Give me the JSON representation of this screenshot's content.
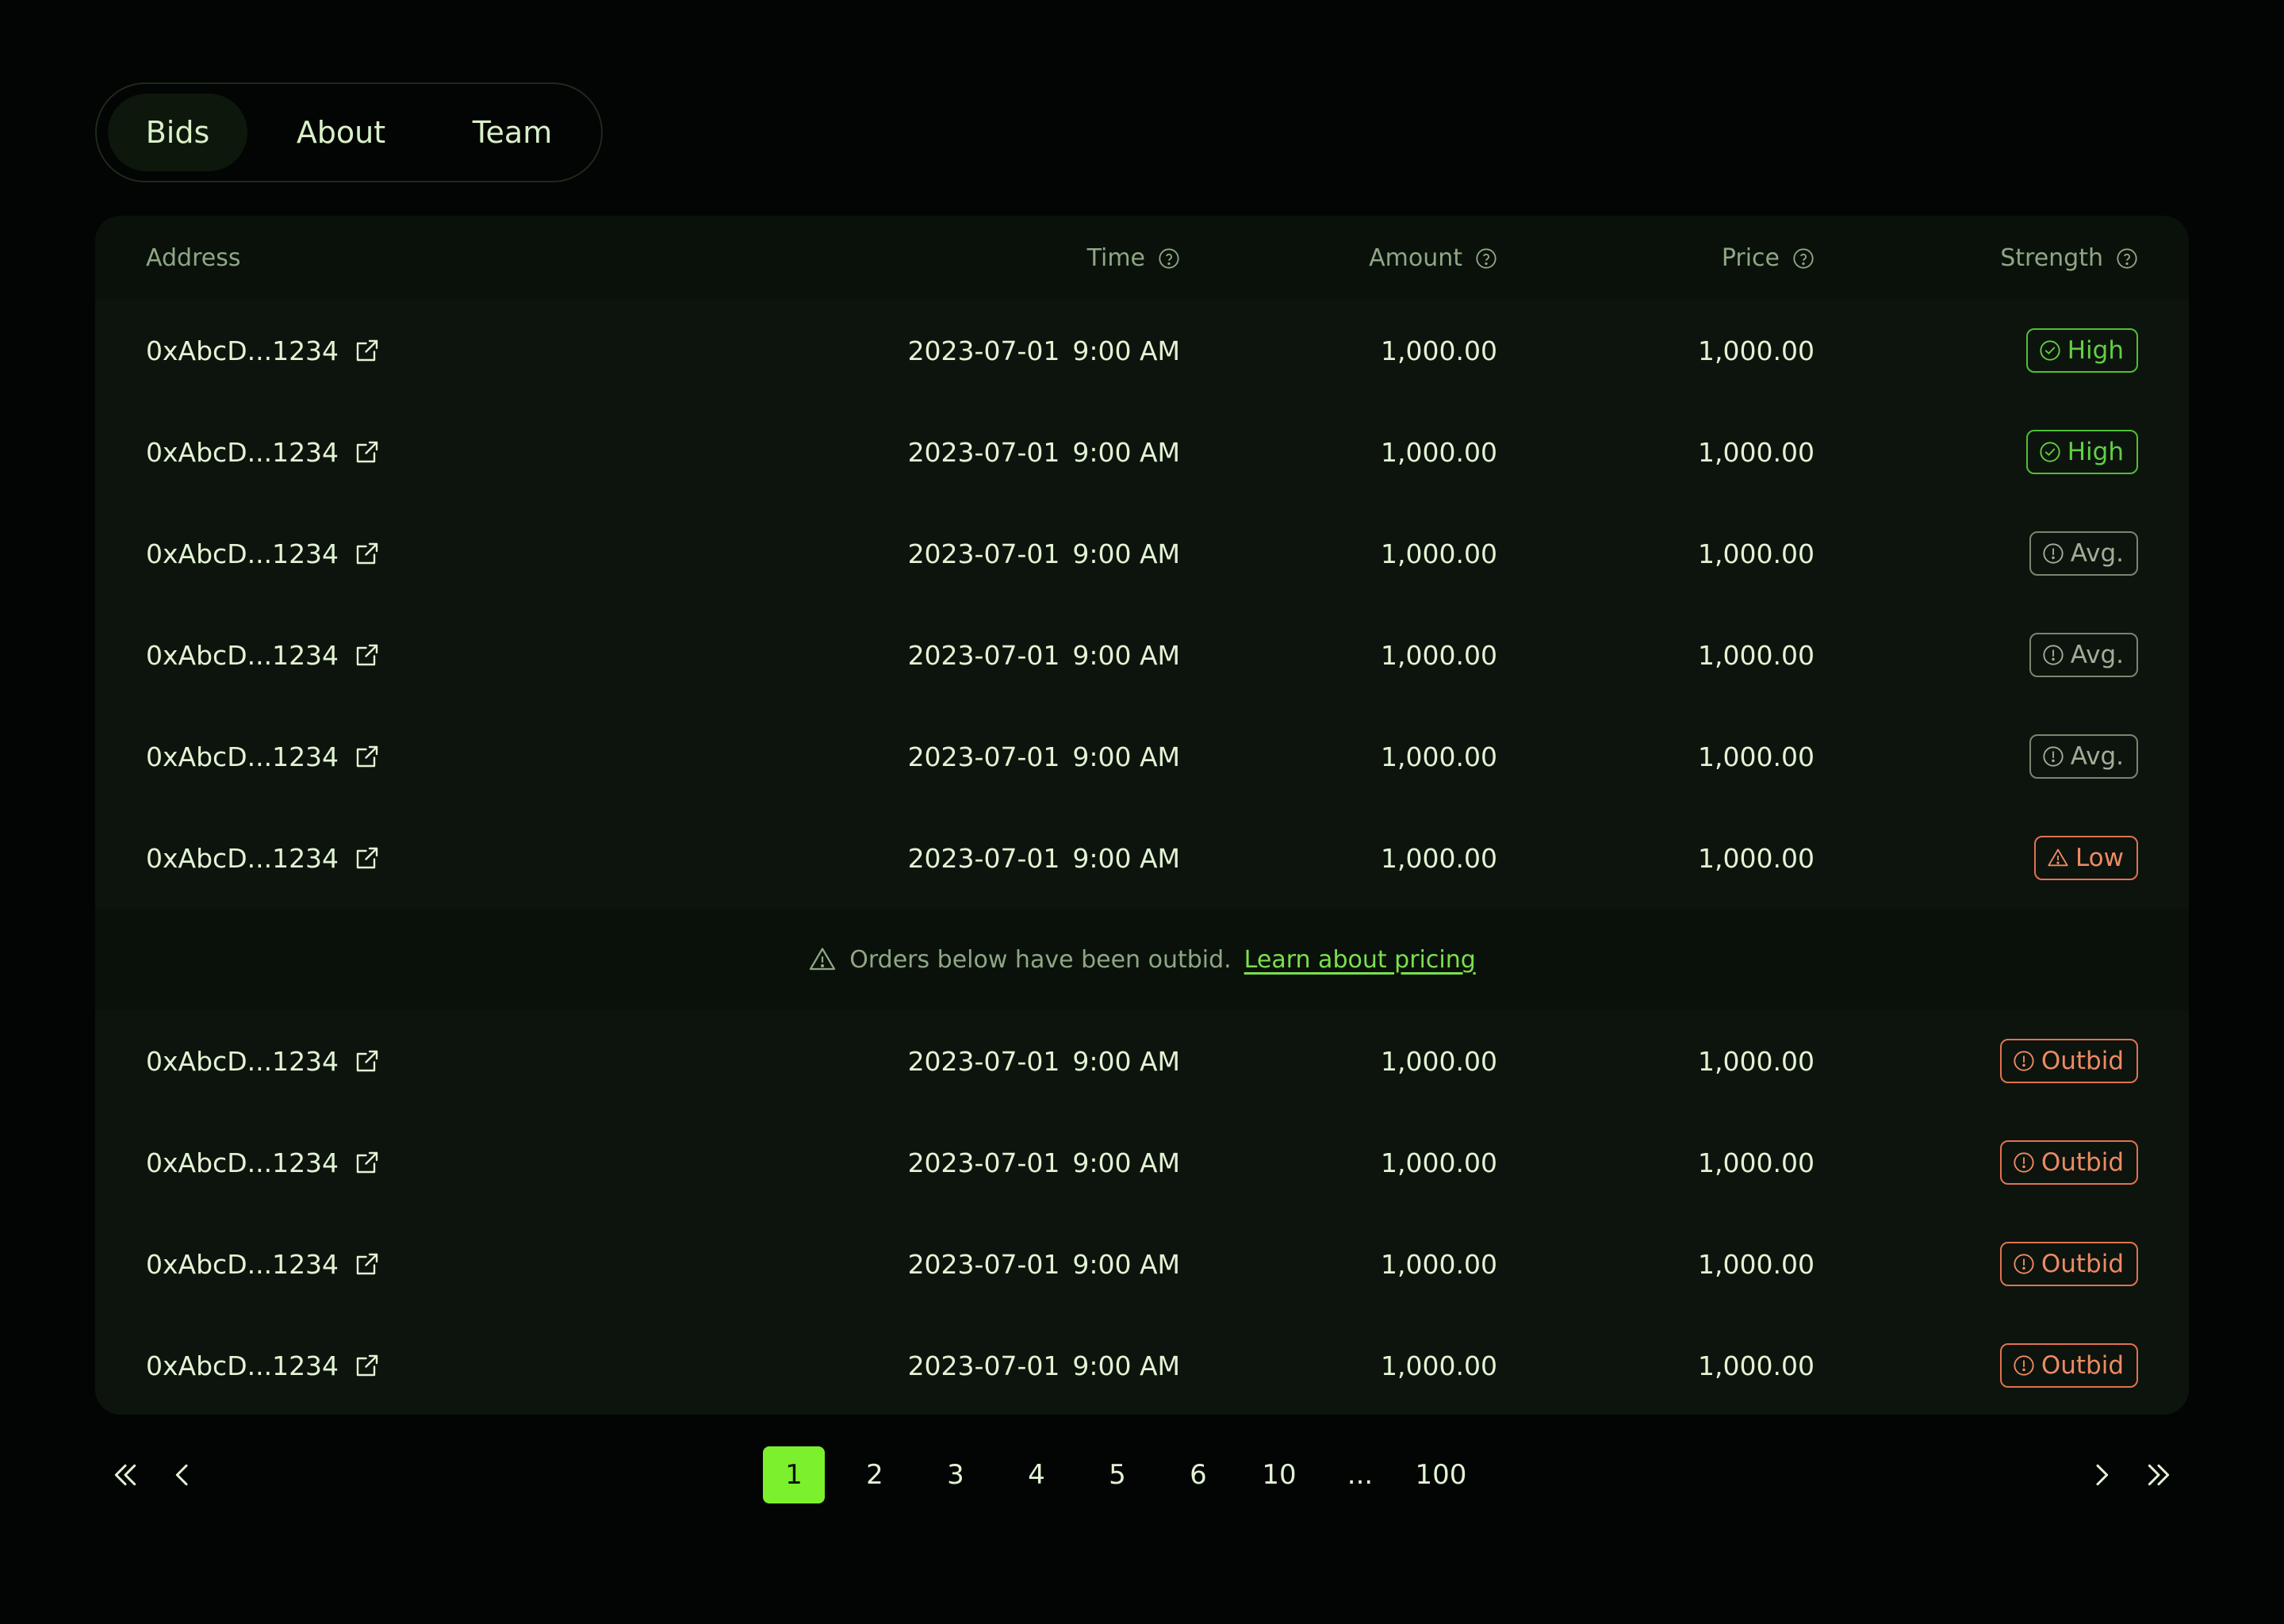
{
  "tabs": [
    {
      "label": "Bids",
      "active": true
    },
    {
      "label": "About",
      "active": false
    },
    {
      "label": "Team",
      "active": false
    }
  ],
  "table": {
    "headers": {
      "address": "Address",
      "time": "Time",
      "amount": "Amount",
      "price": "Price",
      "strength": "Strength"
    },
    "rows": [
      {
        "address": "0xAbcD...1234",
        "date": "2023-07-01",
        "clock": "9:00 AM",
        "amount": "1,000.00",
        "price": "1,000.00",
        "strength": "High"
      },
      {
        "address": "0xAbcD...1234",
        "date": "2023-07-01",
        "clock": "9:00 AM",
        "amount": "1,000.00",
        "price": "1,000.00",
        "strength": "High"
      },
      {
        "address": "0xAbcD...1234",
        "date": "2023-07-01",
        "clock": "9:00 AM",
        "amount": "1,000.00",
        "price": "1,000.00",
        "strength": "Avg."
      },
      {
        "address": "0xAbcD...1234",
        "date": "2023-07-01",
        "clock": "9:00 AM",
        "amount": "1,000.00",
        "price": "1,000.00",
        "strength": "Avg."
      },
      {
        "address": "0xAbcD...1234",
        "date": "2023-07-01",
        "clock": "9:00 AM",
        "amount": "1,000.00",
        "price": "1,000.00",
        "strength": "Avg."
      },
      {
        "address": "0xAbcD...1234",
        "date": "2023-07-01",
        "clock": "9:00 AM",
        "amount": "1,000.00",
        "price": "1,000.00",
        "strength": "Low"
      }
    ],
    "notice": {
      "text": "Orders below have been outbid.",
      "link": "Learn about pricing"
    },
    "outbid_rows": [
      {
        "address": "0xAbcD...1234",
        "date": "2023-07-01",
        "clock": "9:00 AM",
        "amount": "1,000.00",
        "price": "1,000.00",
        "strength": "Outbid"
      },
      {
        "address": "0xAbcD...1234",
        "date": "2023-07-01",
        "clock": "9:00 AM",
        "amount": "1,000.00",
        "price": "1,000.00",
        "strength": "Outbid"
      },
      {
        "address": "0xAbcD...1234",
        "date": "2023-07-01",
        "clock": "9:00 AM",
        "amount": "1,000.00",
        "price": "1,000.00",
        "strength": "Outbid"
      },
      {
        "address": "0xAbcD...1234",
        "date": "2023-07-01",
        "clock": "9:00 AM",
        "amount": "1,000.00",
        "price": "1,000.00",
        "strength": "Outbid"
      }
    ]
  },
  "pagination": {
    "pages": [
      "1",
      "2",
      "3",
      "4",
      "5",
      "6",
      "10",
      "...",
      "100"
    ],
    "current": "1"
  },
  "colors": {
    "background": "#020503",
    "panel": "#0a110a",
    "accent": "#7cf02c",
    "high": "#62cf45",
    "avg": "#9fae97",
    "low": "#ee8a63"
  }
}
